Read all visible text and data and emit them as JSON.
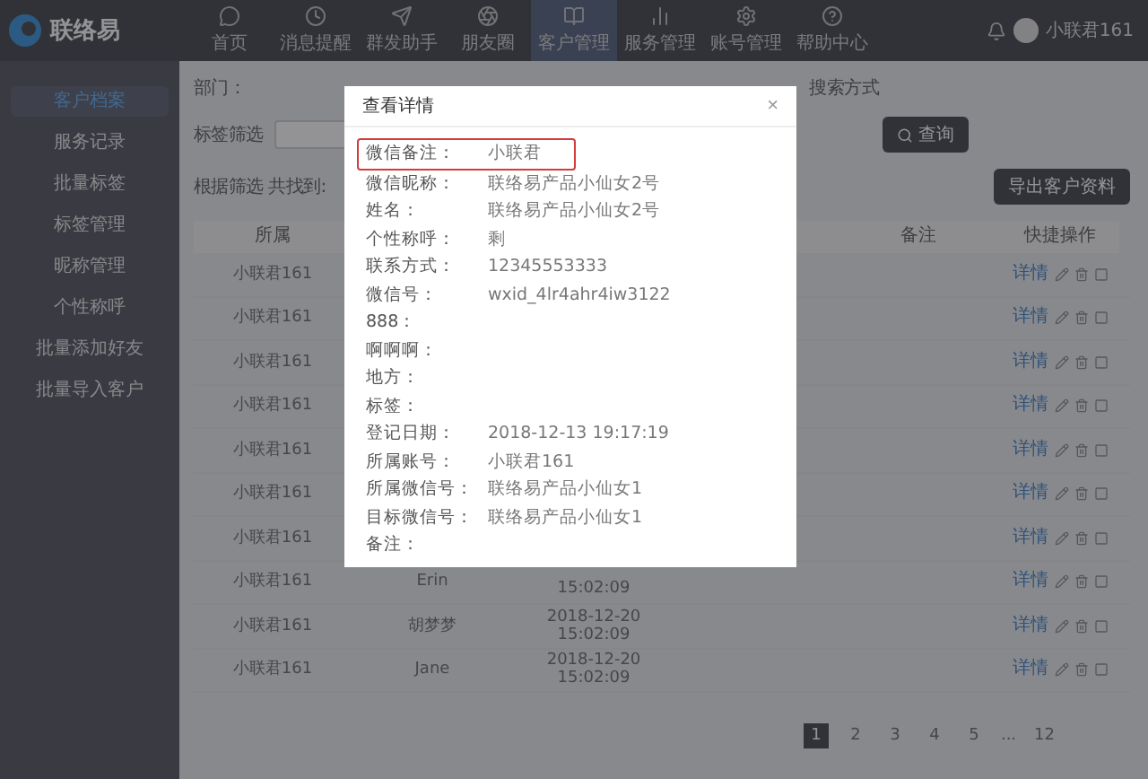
{
  "brand": {
    "name": "联络易"
  },
  "nav": [
    {
      "label": "首页",
      "selected": false
    },
    {
      "label": "消息提醒",
      "selected": false
    },
    {
      "label": "群发助手",
      "selected": false
    },
    {
      "label": "朋友圈",
      "selected": false
    },
    {
      "label": "客户管理",
      "selected": true
    },
    {
      "label": "服务管理",
      "selected": false
    },
    {
      "label": "账号管理",
      "selected": false
    },
    {
      "label": "帮助中心",
      "selected": false
    }
  ],
  "user": {
    "name": "小联君161"
  },
  "sidebar": [
    {
      "label": "客户档案",
      "selected": true
    },
    {
      "label": "服务记录",
      "selected": false
    },
    {
      "label": "批量标签",
      "selected": false
    },
    {
      "label": "标签管理",
      "selected": false
    },
    {
      "label": "昵称管理",
      "selected": false
    },
    {
      "label": "个性称呼",
      "selected": false
    },
    {
      "label": "批量添加好友",
      "selected": false
    },
    {
      "label": "批量导入客户",
      "selected": false
    }
  ],
  "filters": {
    "department_label": "部门：",
    "search_mode_label": "搜索方式",
    "tag_filter_label": "标签筛选",
    "search_button": "查询"
  },
  "summary": "根据筛选 共找到:",
  "export_button": "导出客户资料",
  "table": {
    "columns": [
      {
        "label": "所属"
      },
      {},
      {},
      {},
      {
        "label": "备注"
      },
      {
        "label": "快捷操作"
      }
    ],
    "rows": [
      {
        "owner": "小联君161",
        "action": "详情"
      },
      {
        "owner": "小联君161",
        "action": "详情"
      },
      {
        "owner": "小联君161",
        "action": "详情"
      },
      {
        "owner": "小联君161",
        "action": "详情"
      },
      {
        "owner": "小联君161",
        "action": "详情"
      },
      {
        "owner": "小联君161",
        "action": "详情"
      },
      {
        "owner": "小联君161",
        "action": "详情"
      },
      {
        "owner": "小联君161",
        "name": "Erin",
        "date": "15:02:09",
        "action": "详情"
      },
      {
        "owner": "小联君161",
        "name": "胡梦梦",
        "date": "2018-12-20 15:02:09",
        "action": "详情"
      },
      {
        "owner": "小联君161",
        "name": "Jane",
        "date": "2018-12-20 15:02:09",
        "action": "详情"
      }
    ]
  },
  "pagination": [
    {
      "label": "1",
      "selected": true
    },
    {
      "label": "2",
      "selected": false
    },
    {
      "label": "3",
      "selected": false
    },
    {
      "label": "4",
      "selected": false
    },
    {
      "label": "5",
      "selected": false
    },
    {
      "kind": "gap",
      "label": "..."
    },
    {
      "label": "12",
      "selected": false
    }
  ],
  "modal": {
    "title": "查看详情",
    "close": "×",
    "fields": [
      {
        "label": "微信备注：",
        "value": "小联君",
        "highlighted": true
      },
      {
        "label": "微信昵称：",
        "value": "联络易产品小仙女2号",
        "highlighted": false
      },
      {
        "label": "姓名：",
        "value": "联络易产品小仙女2号",
        "highlighted": false
      },
      {
        "label": "个性称呼：",
        "value": "剩",
        "highlighted": false
      },
      {
        "label": "联系方式：",
        "value": "12345553333",
        "highlighted": false
      },
      {
        "label": "微信号：",
        "value": "wxid_4lr4ahr4iw3122",
        "highlighted": false
      },
      {
        "label": "888：",
        "highlighted": false
      },
      {
        "label": "啊啊啊：",
        "highlighted": false
      },
      {
        "label": "地方：",
        "highlighted": false
      },
      {
        "label": "标签：",
        "highlighted": false
      },
      {
        "label": "登记日期：",
        "value": "2018-12-13 19:17:19",
        "highlighted": false
      },
      {
        "label": "所属账号：",
        "value": "小联君161",
        "highlighted": false
      },
      {
        "label": "所属微信号：",
        "value": "联络易产品小仙女1",
        "highlighted": false
      },
      {
        "label": "目标微信号：",
        "value": "联络易产品小仙女1",
        "highlighted": false
      },
      {
        "label": "备注：",
        "highlighted": false
      }
    ]
  }
}
